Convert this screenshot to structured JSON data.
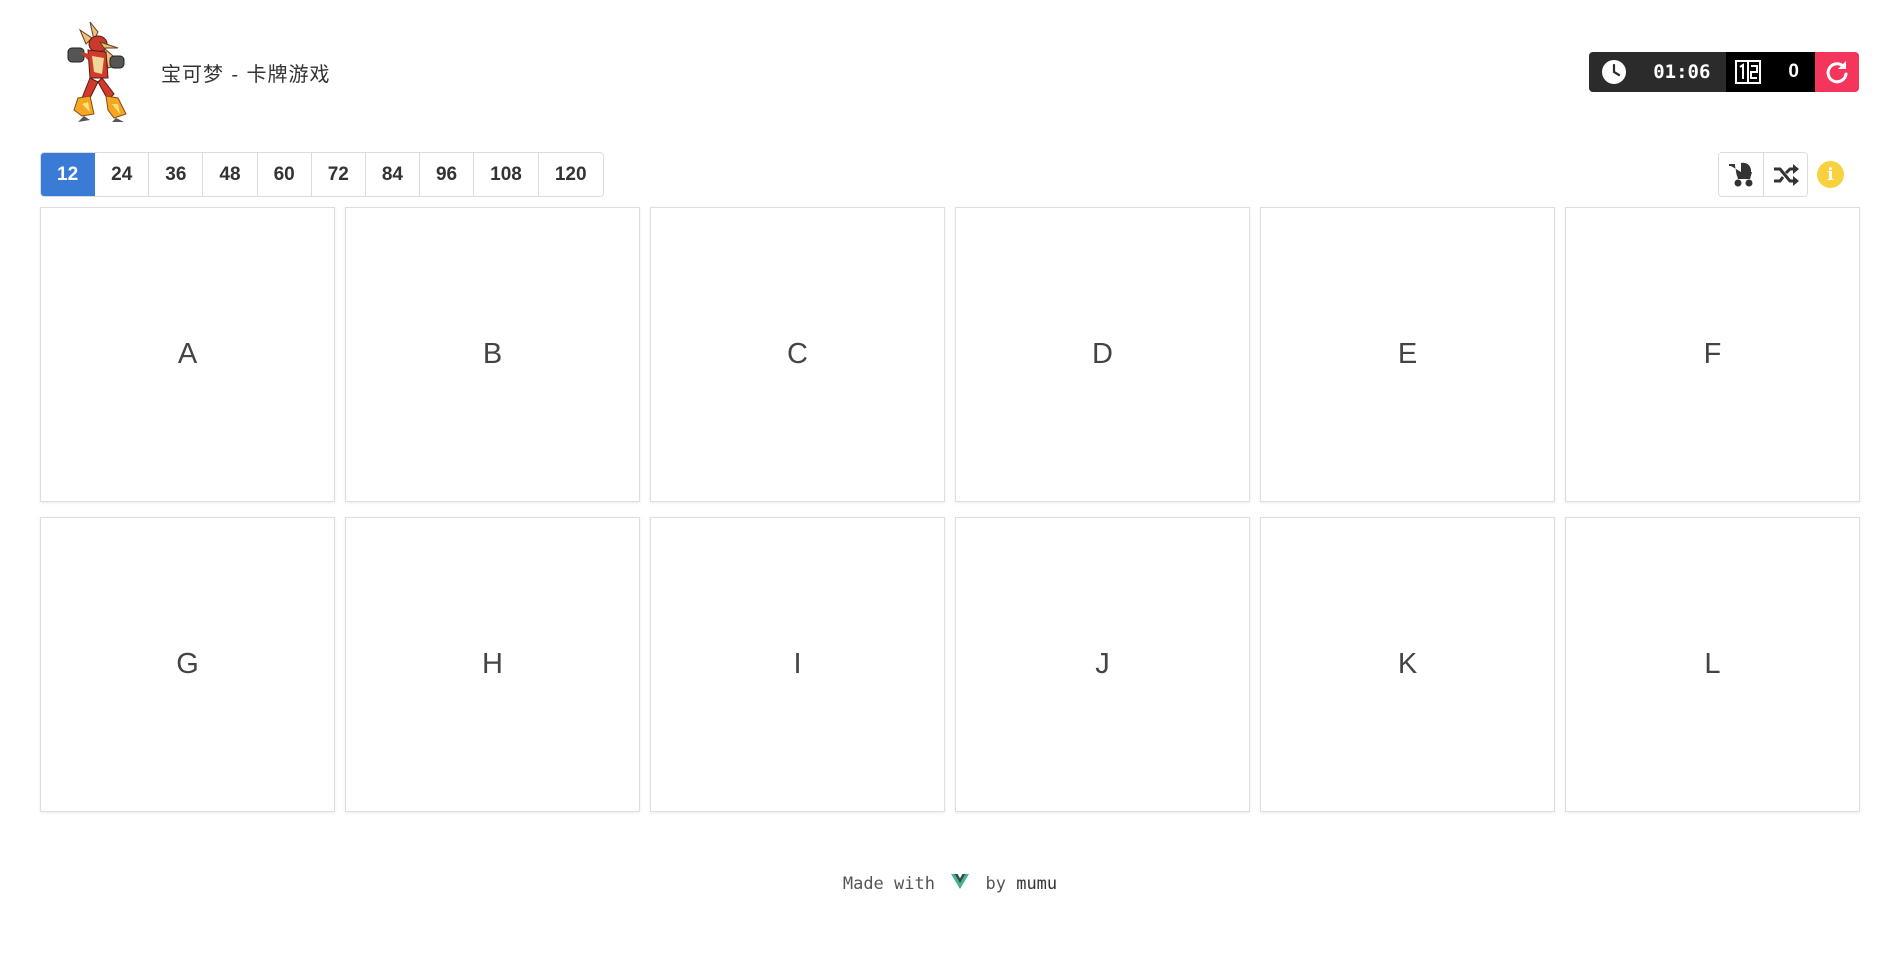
{
  "header": {
    "title": "宝可梦 - 卡牌游戏",
    "logo_icon": "blaziken-sprite-icon",
    "timer": "01:06",
    "steps": "0",
    "colors": {
      "timer_bg": "#2b2b2b",
      "steps_bg": "#000000",
      "restart_bg": "#f5365c"
    }
  },
  "levels": {
    "options": [
      "12",
      "24",
      "36",
      "48",
      "60",
      "72",
      "84",
      "96",
      "108",
      "120"
    ],
    "selected": "12",
    "accent": "#3a7bd5"
  },
  "tools": {
    "icons": [
      "baby-carriage-icon",
      "shuffle-icon",
      "info-icon"
    ]
  },
  "cards": [
    "A",
    "B",
    "C",
    "D",
    "E",
    "F",
    "G",
    "H",
    "I",
    "J",
    "K",
    "L"
  ],
  "footer": {
    "prefix": "Made with",
    "suffix": "by",
    "author": "mumu",
    "vue_color": "#41b883"
  }
}
